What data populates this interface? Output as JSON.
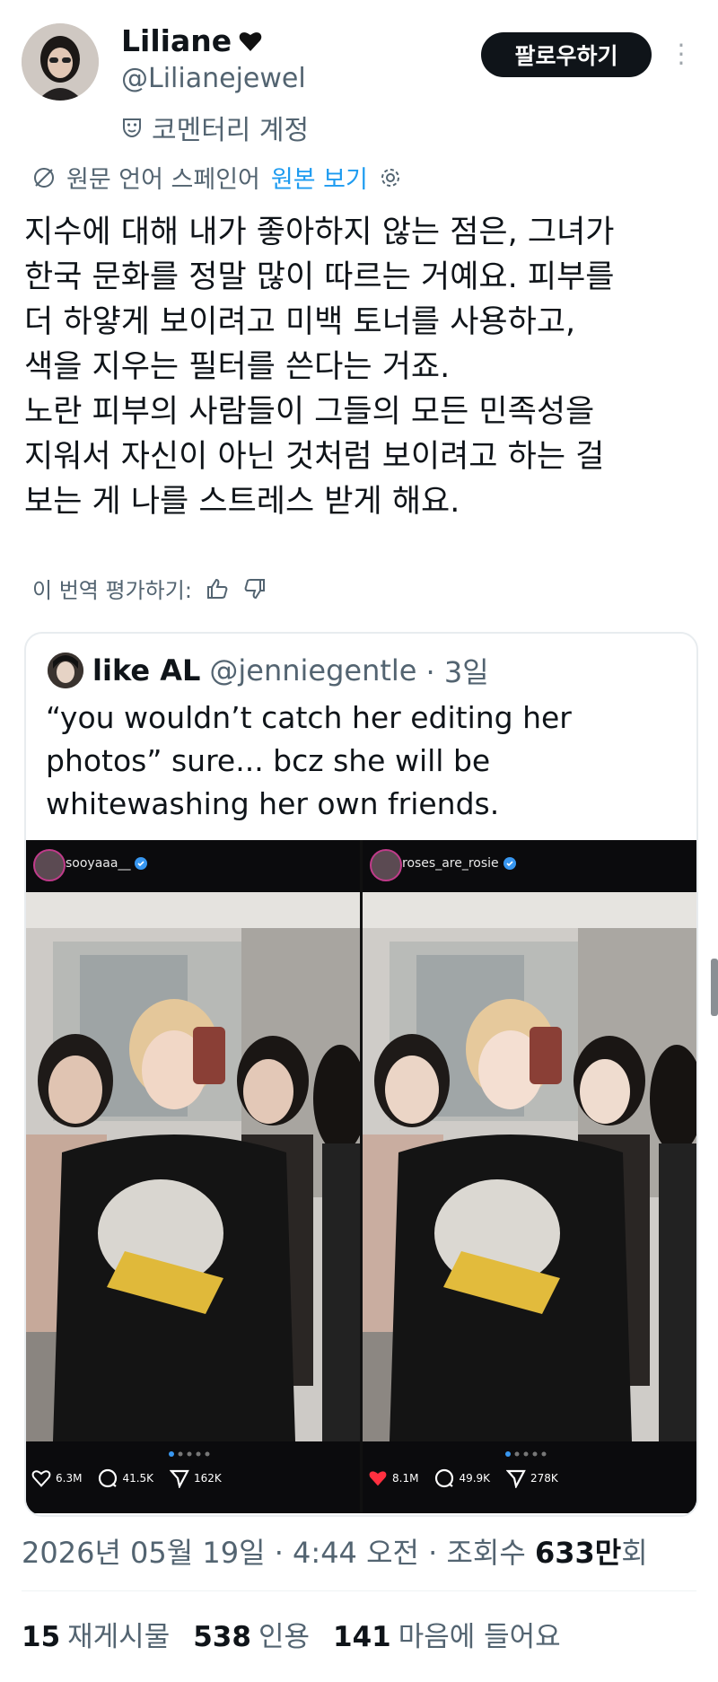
{
  "author": {
    "name": "Liliane",
    "handle": "@Lilianejewel",
    "account_type": "코멘터리 계정",
    "follow_label": "팔로우하기",
    "more_label": "⋮"
  },
  "translation": {
    "source_note": "원문 언어 스페인어",
    "show_original": "원본 보기",
    "rate_label": "이 번역 평가하기:"
  },
  "tweet": {
    "lines": [
      "지수에 대해 내가 좋아하지 않는 점은, 그녀가",
      "한국 문화를 정말 많이 따르는 거예요. 피부를",
      "더 하얗게 보이려고 미백 토너를 사용하고,",
      "색을 지우는 필터를 쓴다는 거죠.",
      "노란 피부의 사람들이 그들의 모든 민족성을",
      "지워서 자신이 아닌 것처럼 보이려고 하는 걸",
      "보는 게 나를 스트레스 받게 해요."
    ]
  },
  "quote": {
    "name": "like AL",
    "handle": "@jenniegentle",
    "time": "· 3일",
    "lines": [
      "“you wouldn’t catch her editing her",
      "photos” sure... bcz she will be",
      "whitewashing her own friends."
    ],
    "panels": [
      {
        "user": "sooyaaa__",
        "likes": "6.3M",
        "comments": "41.5K",
        "shares": "162K",
        "liked": false
      },
      {
        "user": "roses_are_rosie",
        "likes": "8.1M",
        "comments": "49.9K",
        "shares": "278K",
        "liked": true
      }
    ]
  },
  "meta": {
    "date": "2026년 05월 19일 · 4:44 오전 · 조회수 ",
    "views": "633만",
    "views_suffix": "회"
  },
  "counts": {
    "reposts": "15",
    "reposts_label": "재게시물",
    "quotes": "538",
    "quotes_label": "인용",
    "likes": "141",
    "likes_label": "마음에 들어요"
  },
  "colors": {
    "link": "#1d9bf0",
    "secondary": "#536471",
    "like_red": "#f91880"
  }
}
